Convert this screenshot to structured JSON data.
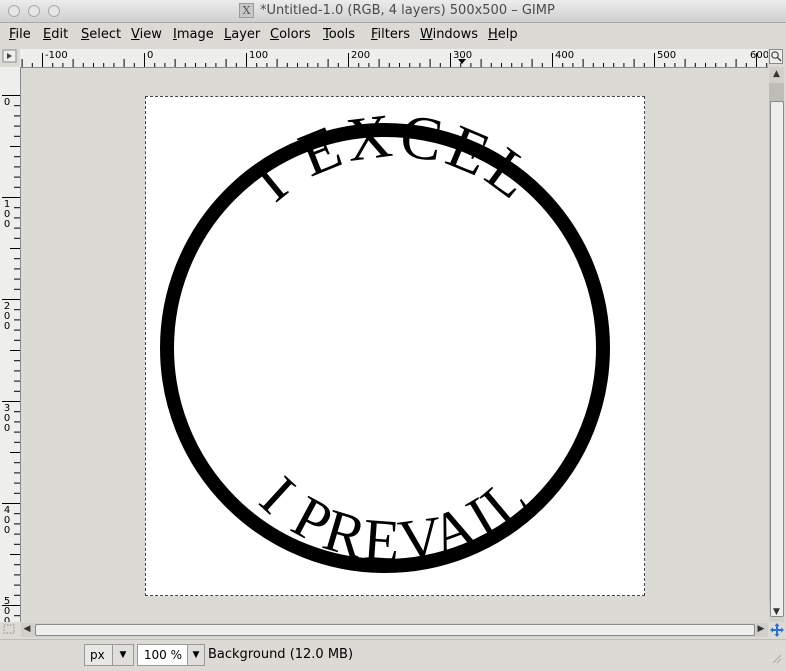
{
  "window": {
    "title": "*Untitled-1.0 (RGB, 4 layers) 500x500 – GIMP",
    "app_icon": "X"
  },
  "menu": [
    "File",
    "Edit",
    "Select",
    "View",
    "Image",
    "Layer",
    "Colors",
    "Tools",
    "Filters",
    "Windows",
    "Help"
  ],
  "ruler": {
    "horizontal": [
      "-100",
      "0",
      "100",
      "200",
      "300",
      "400",
      "500",
      "600"
    ],
    "vertical": [
      "0",
      "100",
      "200",
      "300",
      "400",
      "500"
    ]
  },
  "canvas": {
    "top_text": "I EXCEL",
    "bottom_text": "I PREVAIL"
  },
  "status": {
    "unit": "px",
    "zoom": "100 %",
    "message": "Background (12.0 MB)"
  },
  "icons": {
    "menu_arrow": "triangle-right-icon",
    "zoom_fit": "magnifier-icon",
    "nav": "move-cross-icon",
    "quick_mask": "dotted-square-icon"
  }
}
